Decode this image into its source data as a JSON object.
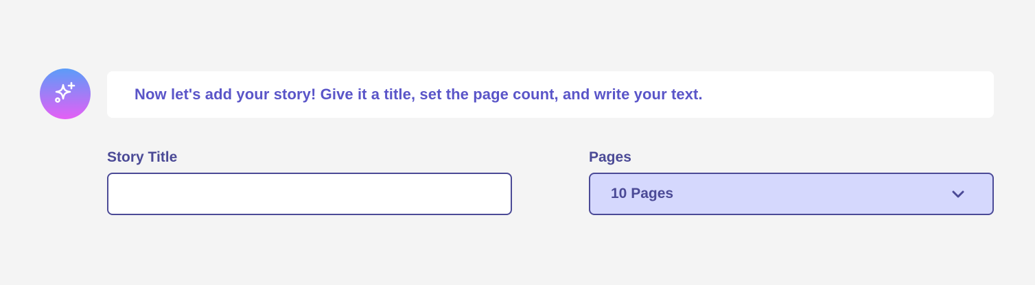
{
  "assistant": {
    "avatar_icon": "sparkles-icon",
    "message": "Now let's add your story! Give it a title, set the page count, and write your text."
  },
  "story_title": {
    "label": "Story Title",
    "value": "",
    "placeholder": ""
  },
  "pages": {
    "label": "Pages",
    "selected": "10 Pages",
    "icon": "chevron-down-icon"
  },
  "colors": {
    "background": "#f4f4f4",
    "accent_text": "#5a55c8",
    "label_text": "#4b4a96",
    "select_fill": "#d5d8fd",
    "avatar_gradient_top": "#5b9cf8",
    "avatar_gradient_bottom": "#e55ff5"
  }
}
